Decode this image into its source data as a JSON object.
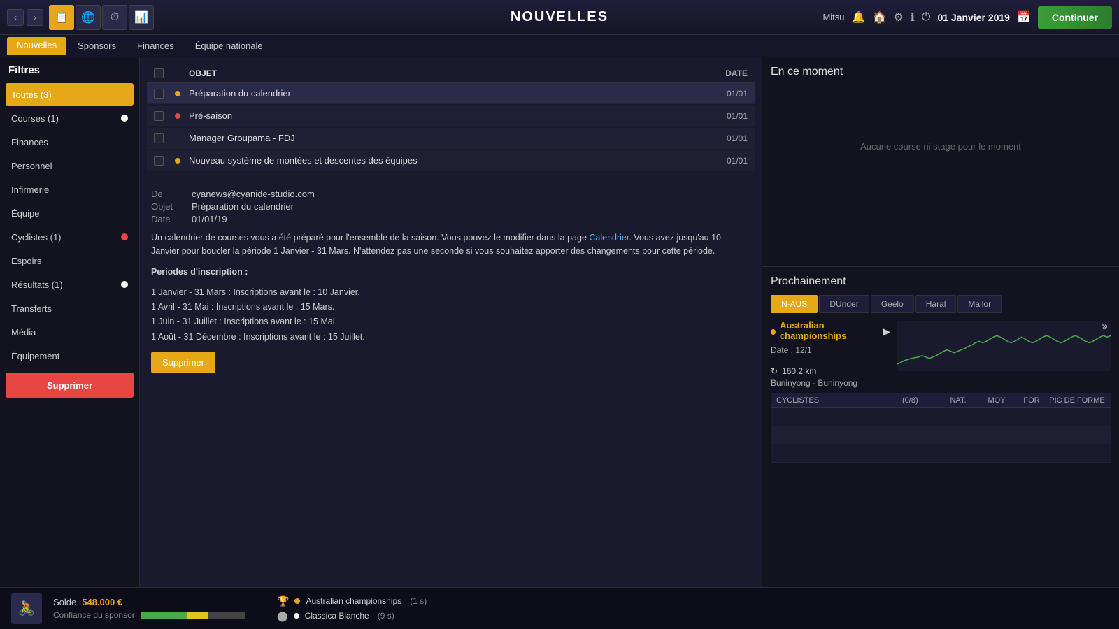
{
  "topbar": {
    "user": "Mitsu",
    "title": "NOUVELLES",
    "date": "01 Janvier 2019",
    "continue_label": "Continuer"
  },
  "subnav": {
    "tabs": [
      {
        "id": "nouvelles",
        "label": "Nouvelles",
        "active": true
      },
      {
        "id": "sponsors",
        "label": "Sponsors",
        "active": false
      },
      {
        "id": "finances",
        "label": "Finances",
        "active": false
      },
      {
        "id": "equipe",
        "label": "Équipe nationale",
        "active": false
      }
    ]
  },
  "sidebar": {
    "title": "Filtres",
    "items": [
      {
        "id": "toutes",
        "label": "Toutes (3)",
        "active": true,
        "badge": "orange"
      },
      {
        "id": "courses",
        "label": "Courses (1)",
        "active": false,
        "badge": "white"
      },
      {
        "id": "finances",
        "label": "Finances",
        "active": false,
        "badge": null
      },
      {
        "id": "personnel",
        "label": "Personnel",
        "active": false,
        "badge": null
      },
      {
        "id": "infirmerie",
        "label": "Infirmerie",
        "active": false,
        "badge": null
      },
      {
        "id": "equipe",
        "label": "Équipe",
        "active": false,
        "badge": null
      },
      {
        "id": "cyclistes",
        "label": "Cyclistes (1)",
        "active": false,
        "badge": "red"
      },
      {
        "id": "espoirs",
        "label": "Espoirs",
        "active": false,
        "badge": null
      },
      {
        "id": "resultats",
        "label": "Résultats (1)",
        "active": false,
        "badge": "white"
      },
      {
        "id": "transferts",
        "label": "Transferts",
        "active": false,
        "badge": null
      },
      {
        "id": "media",
        "label": "Média",
        "active": false,
        "badge": null
      },
      {
        "id": "equipement",
        "label": "Équipement",
        "active": false,
        "badge": null
      }
    ],
    "delete_label": "Supprimer"
  },
  "news_table": {
    "headers": {
      "objet": "OBJET",
      "date": "DATE"
    },
    "rows": [
      {
        "id": 1,
        "dot": "orange",
        "label": "Préparation du calendrier",
        "date": "01/01",
        "selected": true
      },
      {
        "id": 2,
        "dot": "red",
        "label": "Pré-saison",
        "date": "01/01",
        "selected": false
      },
      {
        "id": 3,
        "dot": null,
        "label": "Manager Groupama - FDJ",
        "date": "01/01",
        "selected": false
      },
      {
        "id": 4,
        "dot": "orange",
        "label": "Nouveau système de montées et descentes des équipes",
        "date": "01/01",
        "selected": false
      }
    ]
  },
  "detail": {
    "de_label": "De",
    "de_value": "cyanews@cyanide-studio.com",
    "objet_label": "Objet",
    "objet_value": "Préparation du calendrier",
    "date_label": "Date",
    "date_value": "01/01/19",
    "body_part1": "Un calendrier de courses vous a été préparé pour l'ensemble de la saison. Vous pouvez le modifier dans la page ",
    "body_link": "Calendrier",
    "body_part2": ". Vous avez jusqu'au 10 Janvier pour boucler la période 1 Janvier - 31 Mars. N'attendez pas une seconde si vous souhaitez apporter des changements pour cette période.",
    "periods_title": "Periodes d'inscription :",
    "periods": [
      "1 Janvier - 31 Mars : Inscriptions avant le : 10 Janvier.",
      "1 Avril - 31 Mai : Inscriptions avant le : 15 Mars.",
      "1 Juin - 31 Juillet : Inscriptions avant le : 15 Mai.",
      "1 Août - 31 Décembre : Inscriptions avant le : 15 Juillet."
    ],
    "delete_label": "Supprimer"
  },
  "en_ce_moment": {
    "title": "En ce moment",
    "empty_text": "Aucune course ni stage pour le moment"
  },
  "prochainement": {
    "title": "Prochainement",
    "tabs": [
      {
        "id": "n-aus",
        "label": "N-AUS",
        "active": true
      },
      {
        "id": "dunder",
        "label": "DUnder",
        "active": false
      },
      {
        "id": "geelo",
        "label": "Geelo",
        "active": false
      },
      {
        "id": "haral",
        "label": "Haral",
        "active": false
      },
      {
        "id": "mallor",
        "label": "Mallor",
        "active": false
      }
    ],
    "race": {
      "name": "Australian championships",
      "date_label": "Date : 12/1",
      "distance": "160.2 km",
      "route": "Buninyong - Buninyong"
    },
    "cyclistes": {
      "headers": {
        "name": "CYCLISTES",
        "count": "(0/8)",
        "nat": "NAT.",
        "moy": "MOY",
        "for": "FOR",
        "pic": "PIC DE FORME"
      },
      "rows": [
        {
          "id": 1
        },
        {
          "id": 2
        },
        {
          "id": 3
        }
      ]
    }
  },
  "bottom": {
    "solde_label": "Solde",
    "solde_value": "548.000 €",
    "sponsor_label": "Confiance du sponsor",
    "races": [
      {
        "icon": "trophy",
        "dot": "orange",
        "name": "Australian championships",
        "time": "(1 s)"
      },
      {
        "icon": "circle",
        "dot": "white",
        "name": "Classica Bianche",
        "time": "(9 s)"
      }
    ]
  }
}
